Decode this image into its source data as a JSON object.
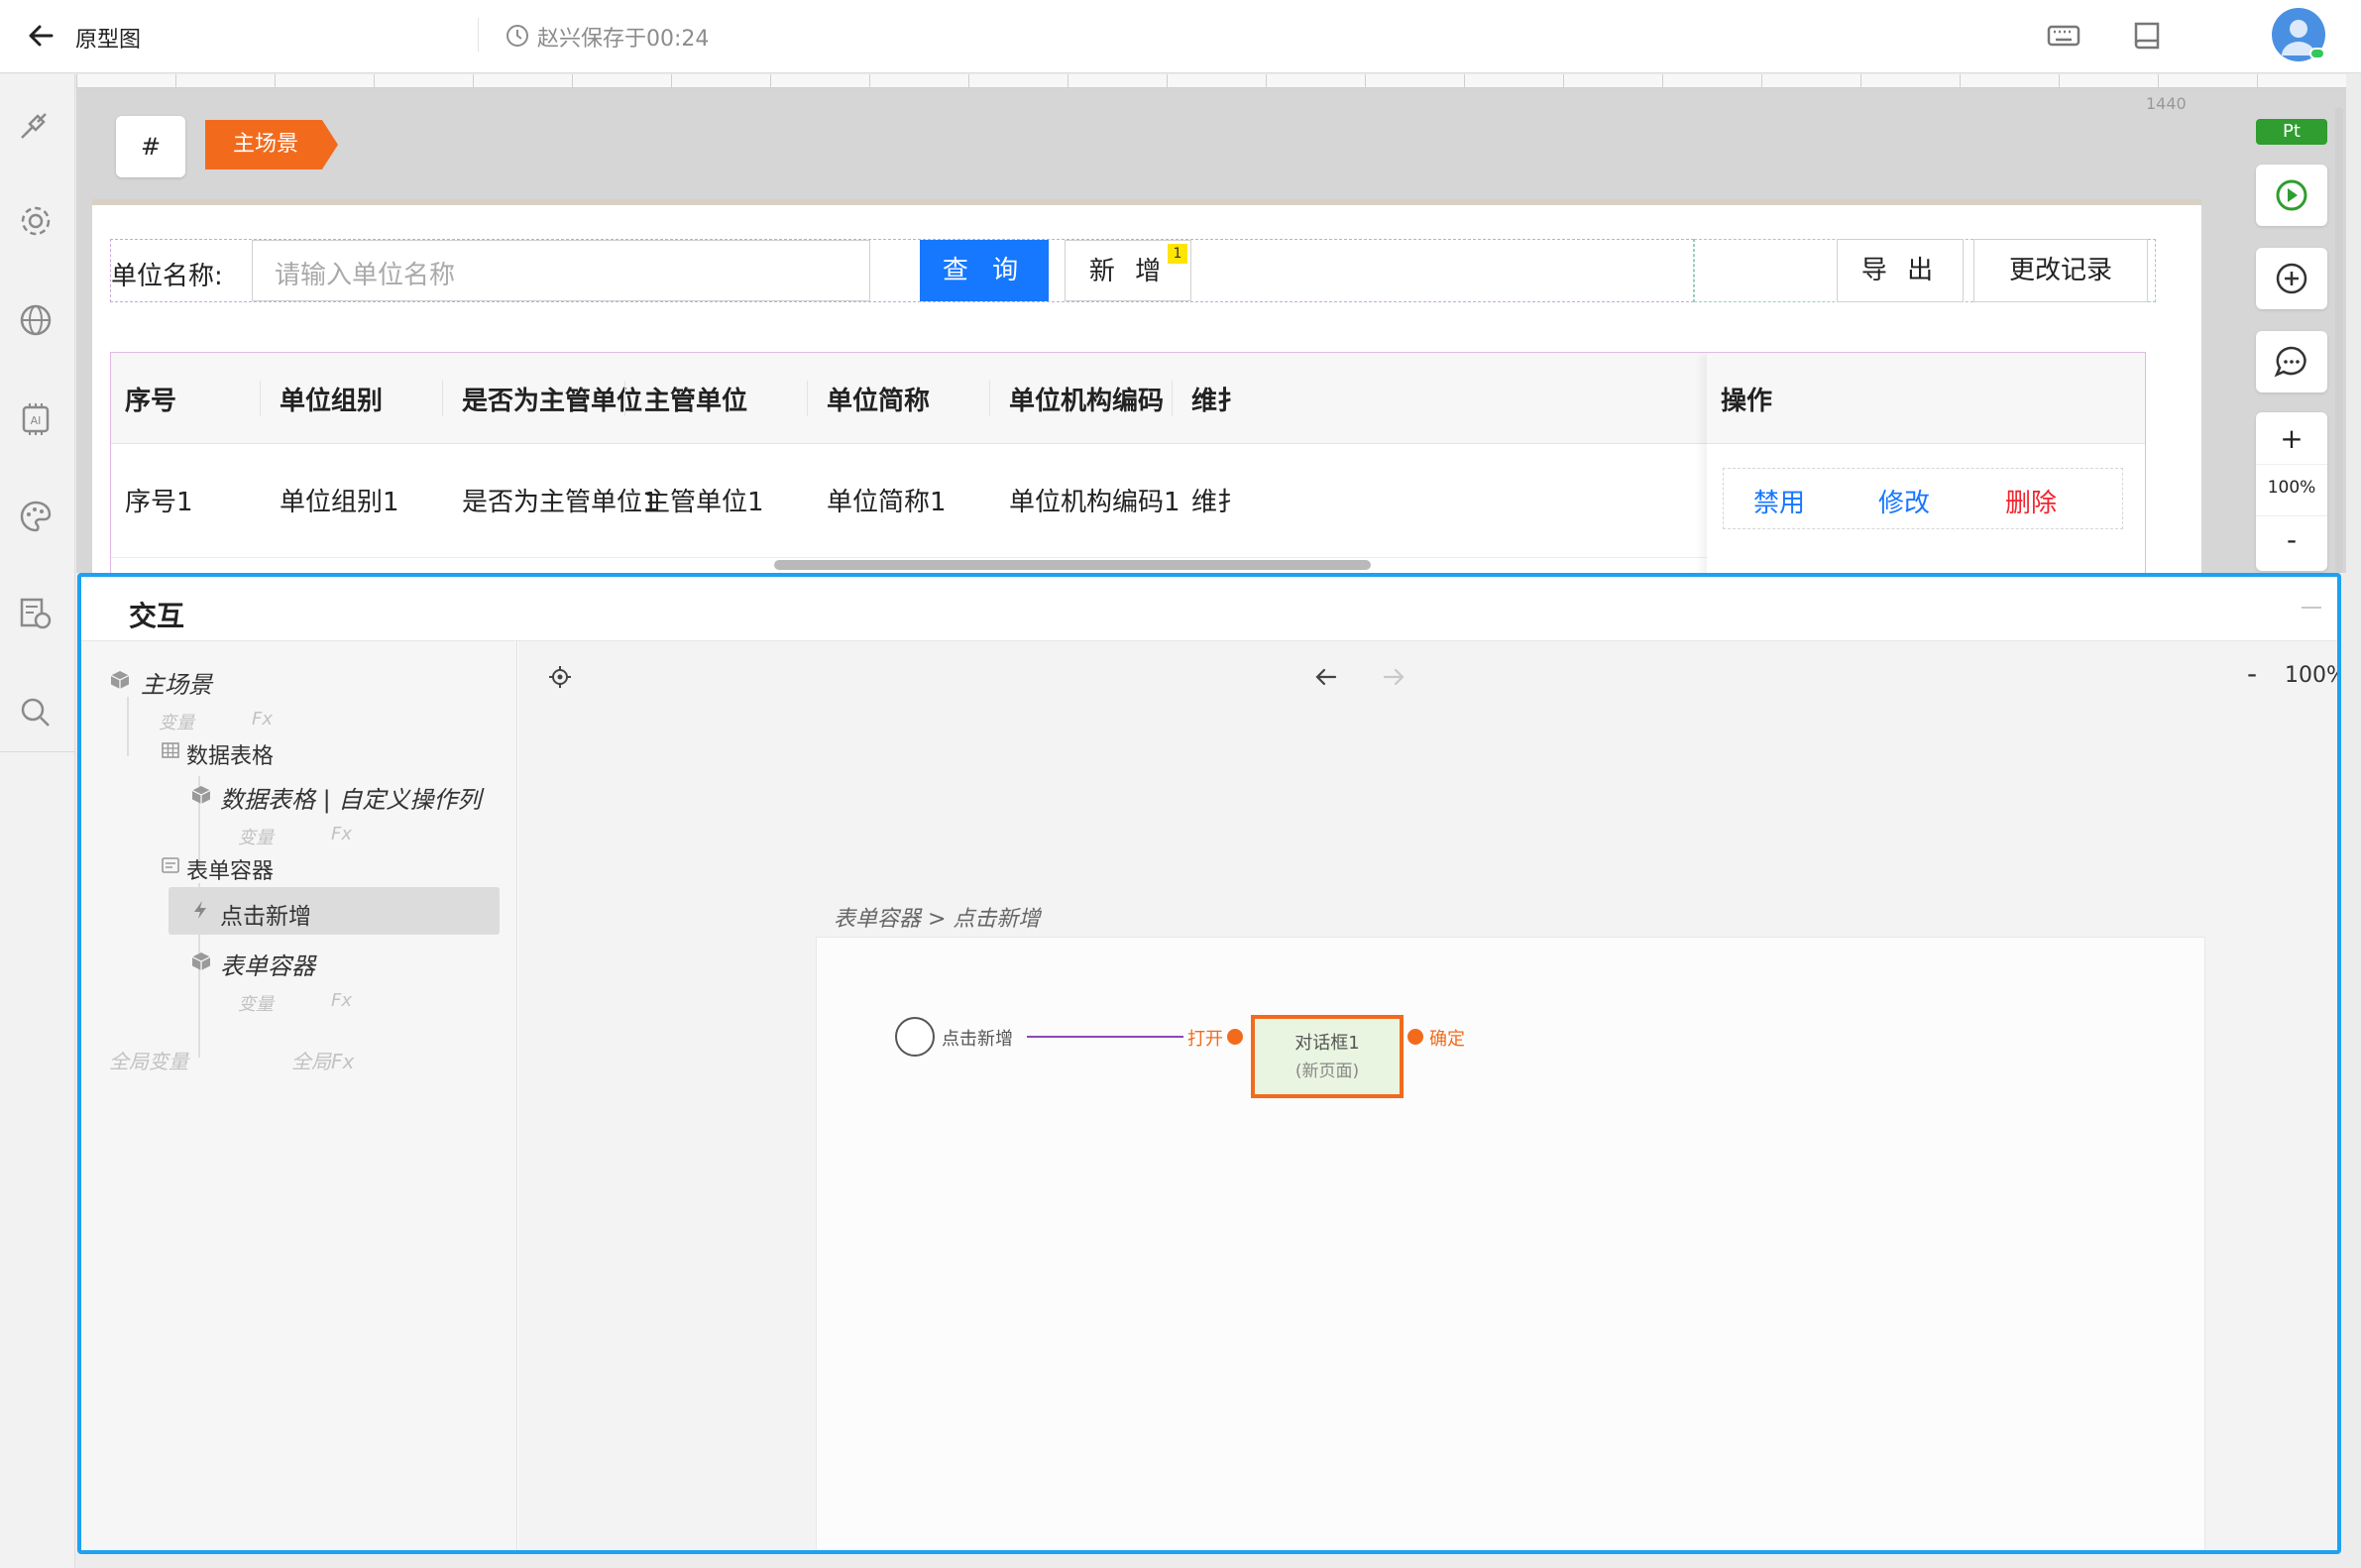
{
  "topbar": {
    "title": "原型图",
    "save_status": "赵兴保存于00:24"
  },
  "canvas": {
    "ruler_mark": "1440",
    "hash_label": "#",
    "scene_tag": "主场景",
    "search": {
      "label": "单位名称:",
      "placeholder": "请输入单位名称",
      "query_button": "查 询",
      "add_button": "新 增",
      "add_badge": "1",
      "export_button": "导 出",
      "log_button": "更改记录"
    },
    "table": {
      "headers": [
        "序号",
        "单位组别",
        "是否为主管单位",
        "主管单位",
        "单位简称",
        "单位机构编码",
        "维扌",
        "操作"
      ],
      "rows": [
        [
          "序号1",
          "单位组别1",
          "是否为主管单位1",
          "主管单位1",
          "单位简称1",
          "单位机构编码1",
          "维扌"
        ]
      ],
      "actions": [
        "禁用",
        "修改",
        "删除"
      ]
    }
  },
  "tools": {
    "pt": "Pt",
    "zoom_plus": "+",
    "zoom_value": "100%",
    "zoom_minus": "-"
  },
  "panel": {
    "title": "交互",
    "tree": {
      "root": "主场景",
      "var": "变量",
      "fx": "Fx",
      "data_table": "数据表格",
      "data_table_child": "数据表格 | 自定义操作列",
      "form_container": "表单容器",
      "click_add": "点击新增",
      "form_container_child": "表单容器",
      "global_var": "全局变量",
      "global_fx": "全局Fx"
    },
    "flow": {
      "zoom_minus": "-",
      "zoom_value": "100%",
      "zoom_plus": "+",
      "breadcrumb": "表单容器 > 点击新增",
      "start_label": "点击新增",
      "open_label": "打开",
      "dialog_title": "对话框1",
      "dialog_sub": "(新页面)",
      "confirm_label": "确定"
    }
  },
  "colors": {
    "accent_blue": "#1677ff",
    "panel_border": "#1da1f2",
    "scene_orange": "#f26b1d",
    "delete_red": "#f5222d",
    "pt_green": "#2f9d2f"
  }
}
